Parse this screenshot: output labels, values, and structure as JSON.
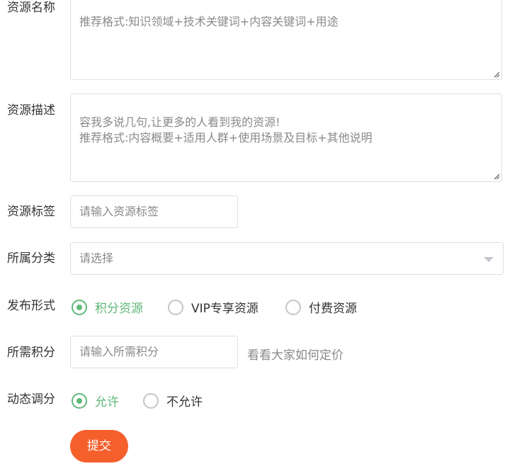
{
  "form": {
    "name": {
      "label": "资源名称",
      "placeholder": "推荐格式:知识领域+技术关键词+内容关键词+用途"
    },
    "description": {
      "label": "资源描述",
      "placeholder": "容我多说几句,让更多的人看到我的资源!\n推荐格式:内容概要+适用人群+使用场景及目标+其他说明"
    },
    "tags": {
      "label": "资源标签",
      "placeholder": "请输入资源标签"
    },
    "category": {
      "label": "所属分类",
      "selected": "请选择"
    },
    "publish_type": {
      "label": "发布形式",
      "options": [
        {
          "label": "积分资源",
          "checked": true
        },
        {
          "label": "VIP专享资源",
          "checked": false
        },
        {
          "label": "付费资源",
          "checked": false
        }
      ]
    },
    "points": {
      "label": "所需积分",
      "placeholder": "请输入所需积分",
      "hint": "看看大家如何定价"
    },
    "dynamic_points": {
      "label": "动态调分",
      "options": [
        {
          "label": "允许",
          "checked": true
        },
        {
          "label": "不允许",
          "checked": false
        }
      ]
    },
    "submit_label": "提交"
  },
  "colors": {
    "accent_green": "#5fb878",
    "submit_orange": "#f55f2c",
    "placeholder_gray": "#8a8a8a",
    "border_gray": "#dcdfe6"
  },
  "icons": {
    "resize": "resize-grip-icon",
    "dropdown": "caret-down-icon"
  }
}
